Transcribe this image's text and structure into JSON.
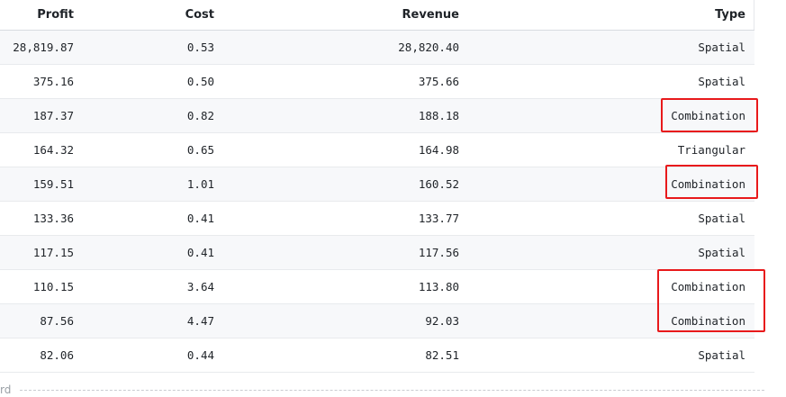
{
  "table": {
    "headers": [
      "Profit",
      "Cost",
      "Revenue",
      "Type"
    ],
    "rows": [
      {
        "profit": "28,819.87",
        "cost": "0.53",
        "revenue": "28,820.40",
        "type": "Spatial"
      },
      {
        "profit": "375.16",
        "cost": "0.50",
        "revenue": "375.66",
        "type": "Spatial"
      },
      {
        "profit": "187.37",
        "cost": "0.82",
        "revenue": "188.18",
        "type": "Combination"
      },
      {
        "profit": "164.32",
        "cost": "0.65",
        "revenue": "164.98",
        "type": "Triangular"
      },
      {
        "profit": "159.51",
        "cost": "1.01",
        "revenue": "160.52",
        "type": "Combination"
      },
      {
        "profit": "133.36",
        "cost": "0.41",
        "revenue": "133.77",
        "type": "Spatial"
      },
      {
        "profit": "117.15",
        "cost": "0.41",
        "revenue": "117.56",
        "type": "Spatial"
      },
      {
        "profit": "110.15",
        "cost": "3.64",
        "revenue": "113.80",
        "type": "Combination"
      },
      {
        "profit": "87.56",
        "cost": "4.47",
        "revenue": "92.03",
        "type": "Combination"
      },
      {
        "profit": "82.06",
        "cost": "0.44",
        "revenue": "82.51",
        "type": "Spatial"
      }
    ]
  },
  "footer": {
    "partial_text": "rd"
  },
  "colors": {
    "highlight": "#e8191b",
    "row_stripe": "#f7f8fa"
  }
}
